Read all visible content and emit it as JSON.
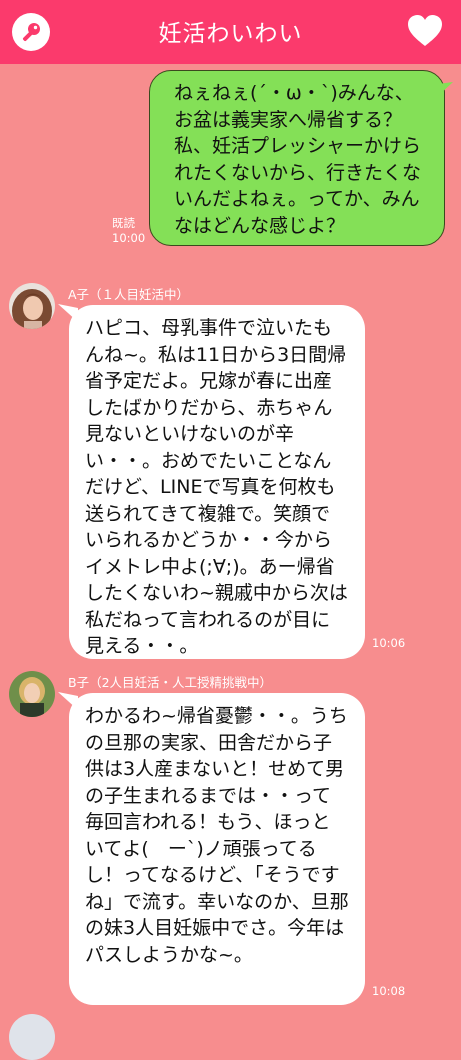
{
  "header": {
    "title": "妊活わいわい",
    "left_icon": "key-icon",
    "right_icon": "heart-icon"
  },
  "colors": {
    "header": "#fb3a6c",
    "background": "#f78d8e",
    "outgoing_bubble": "#84e057",
    "incoming_bubble": "#ffffff"
  },
  "messages": [
    {
      "side": "me",
      "text": "ねぇねぇ(´・ω・`)みんな、お盆は義実家へ帰省する？私、妊活プレッシャーかけられたくないから、行きたくないんだよねぇ。ってか、みんなはどんな感じよ？",
      "read": "既読",
      "time": "10:00"
    },
    {
      "side": "other",
      "sender": "A子（１人目妊活中）",
      "text": "ハピコ、母乳事件で泣いたもんね~。私は11日から3日間帰省予定だよ。兄嫁が春に出産したばかりだから、赤ちゃん見ないといけないのが辛い・・。おめでたいことなんだけど、LINEで写真を何枚も送られてきて複雑で。笑顔でいられるかどうか・・今からイメトレ中よ(;∀;)。あー帰省したくないわ~親戚中から次は私だねって言われるのが目に見える・・。",
      "time": "10:06"
    },
    {
      "side": "other",
      "sender": "B子（2人目妊活・人工授精挑戦中）",
      "text": "わかるわ~帰省憂鬱・・。うちの旦那の実家、田舎だから子供は3人産まないと！せめて男の子生まれるまでは・・って毎回言われる！もう、ほっといてよ(　ー`)ノ頑張ってるし！ってなるけど、「そうですね」で流す。幸いなのか、旦那の妹3人目妊娠中でさ。今年はパスしようかな~。",
      "time": "10:08"
    }
  ]
}
